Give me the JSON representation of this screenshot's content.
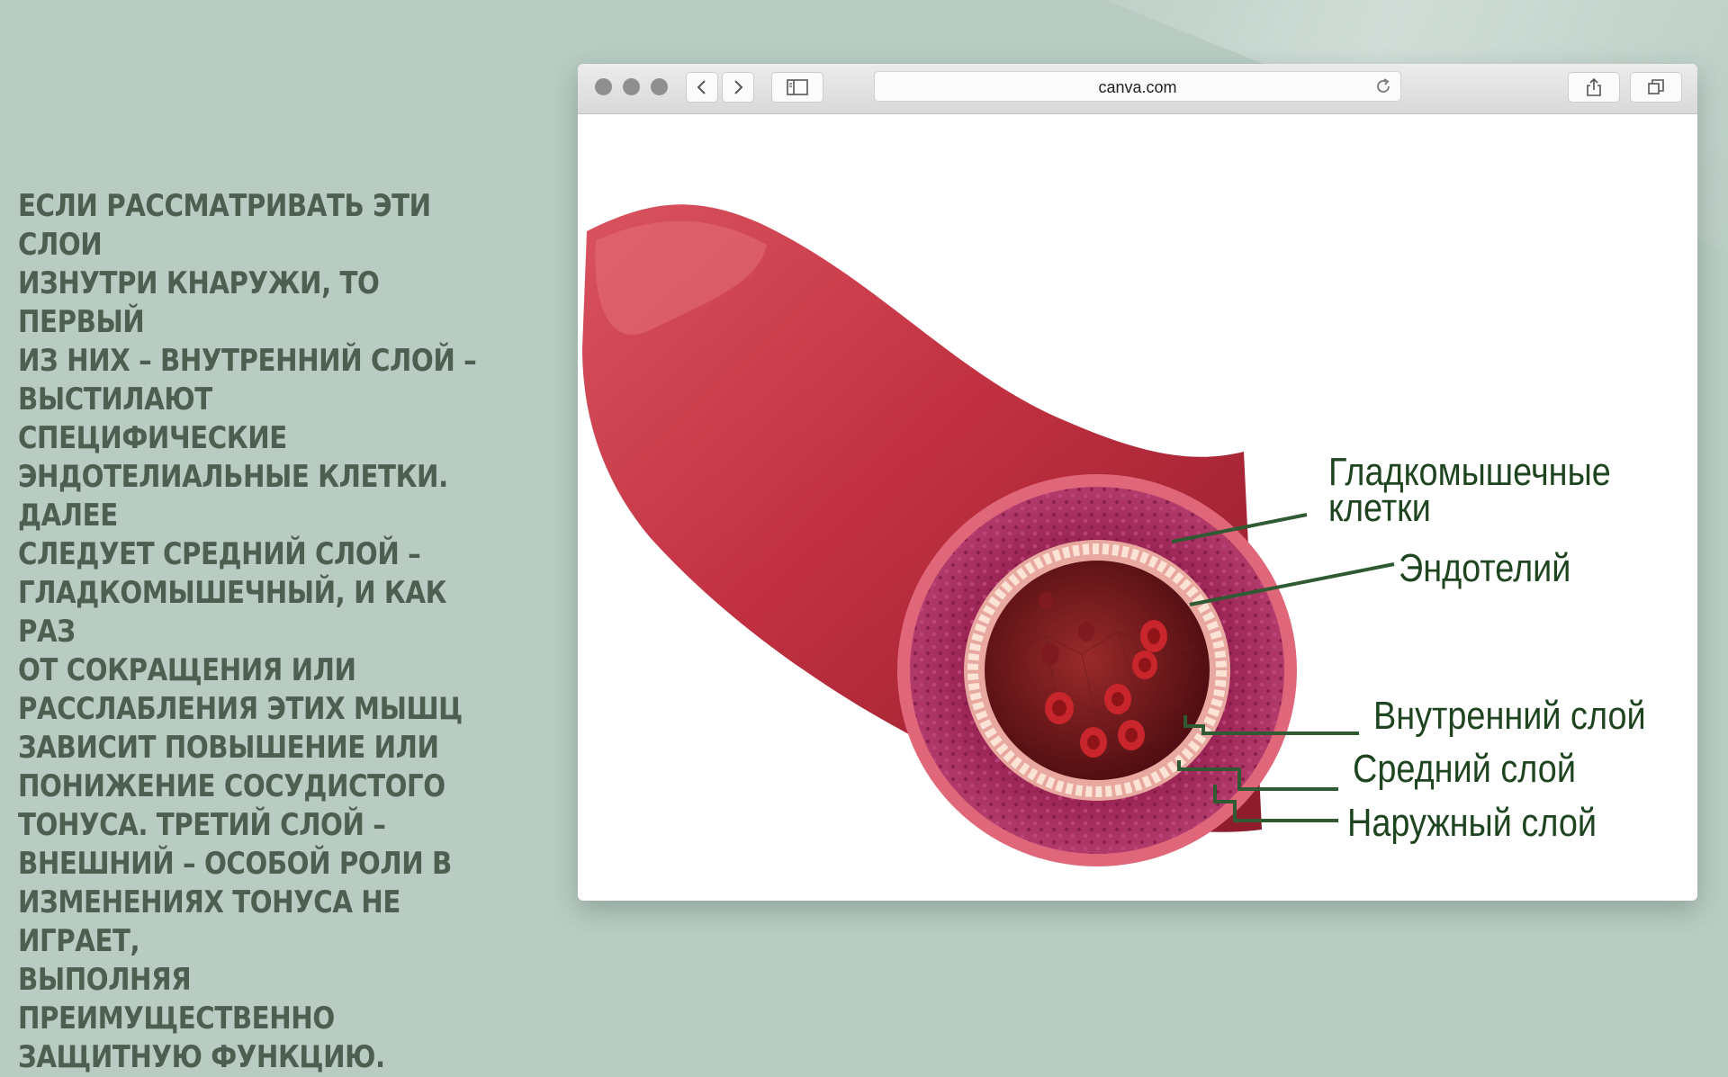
{
  "slide": {
    "body_text": "ЕСЛИ РАССМАТРИВАТЬ ЭТИ СЛОИ\nИЗНУТРИ КНАРУЖИ, ТО ПЕРВЫЙ\nИЗ НИХ – ВНУТРЕННИЙ СЛОЙ –\nВЫСТИЛАЮТ СПЕЦИФИЧЕСКИЕ\nЭНДОТЕЛИАЛЬНЫЕ КЛЕТКИ. ДАЛЕЕ\nСЛЕДУЕТ СРЕДНИЙ СЛОЙ –\nГЛАДКОМЫШЕЧНЫЙ, И КАК РАЗ\nОТ СОКРАЩЕНИЯ ИЛИ\nРАССЛАБЛЕНИЯ ЭТИХ МЫШЦ\nЗАВИСИТ ПОВЫШЕНИЕ ИЛИ\nПОНИЖЕНИЕ СОСУДИСТОГО\nТОНУСА. ТРЕТИЙ СЛОЙ –\nВНЕШНИЙ – ОСОБОЙ РОЛИ В\nИЗМЕНЕНИЯХ ТОНУСА НЕ ИГРАЕТ,\nВЫПОЛНЯЯ ПРЕИМУЩЕСТВЕННО\nЗАЩИТНУЮ ФУНКЦИЮ.",
    "text_color": "#4c5f50",
    "background_color": "#b8ccc3"
  },
  "browser": {
    "url": "canva.com",
    "icons": {
      "back": "chevron-left-icon",
      "forward": "chevron-right-icon",
      "sidebar": "sidebar-icon",
      "reload": "reload-icon",
      "share": "share-icon",
      "tabs": "tabs-icon"
    }
  },
  "diagram": {
    "labels": {
      "smooth_muscle": "Гладкомышечные\nклетки",
      "endothelium": "Эндотелий",
      "inner_layer": "Внутренний слой",
      "middle_layer": "Средний слой",
      "outer_layer": "Наружный слой"
    },
    "colors": {
      "vessel": "#c3303f",
      "label_text": "#1e4420",
      "leader_line": "#2f5a32"
    }
  }
}
